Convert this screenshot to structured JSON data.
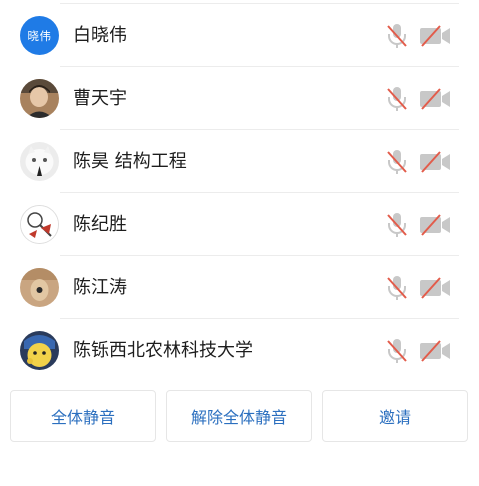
{
  "participants": [
    {
      "name": "白晓伟",
      "avatar_text": "晓伟",
      "avatar_type": "initials",
      "mic": "muted",
      "camera": "off"
    },
    {
      "name": "曹天宇",
      "avatar_type": "photo",
      "mic": "muted",
      "camera": "off"
    },
    {
      "name": "陈昊 结构工程",
      "avatar_type": "photo",
      "mic": "muted",
      "camera": "off"
    },
    {
      "name": "陈纪胜",
      "avatar_type": "photo",
      "mic": "muted",
      "camera": "off"
    },
    {
      "name": "陈江涛",
      "avatar_type": "photo",
      "mic": "muted",
      "camera": "off"
    },
    {
      "name": "陈铄西北农林科技大学",
      "avatar_type": "photo",
      "mic": "muted",
      "camera": "off"
    }
  ],
  "actions": {
    "mute_all_label": "全体静音",
    "unmute_all_label": "解除全体静音",
    "invite_label": "邀请"
  },
  "colors": {
    "accent": "#2b6fbf",
    "avatar_bg": "#1f7be6",
    "muted_icon": "#c8c8c8",
    "muted_slash": "#e25c4b"
  },
  "icons": {
    "mic": "mic-muted-icon",
    "camera": "camera-off-icon"
  }
}
